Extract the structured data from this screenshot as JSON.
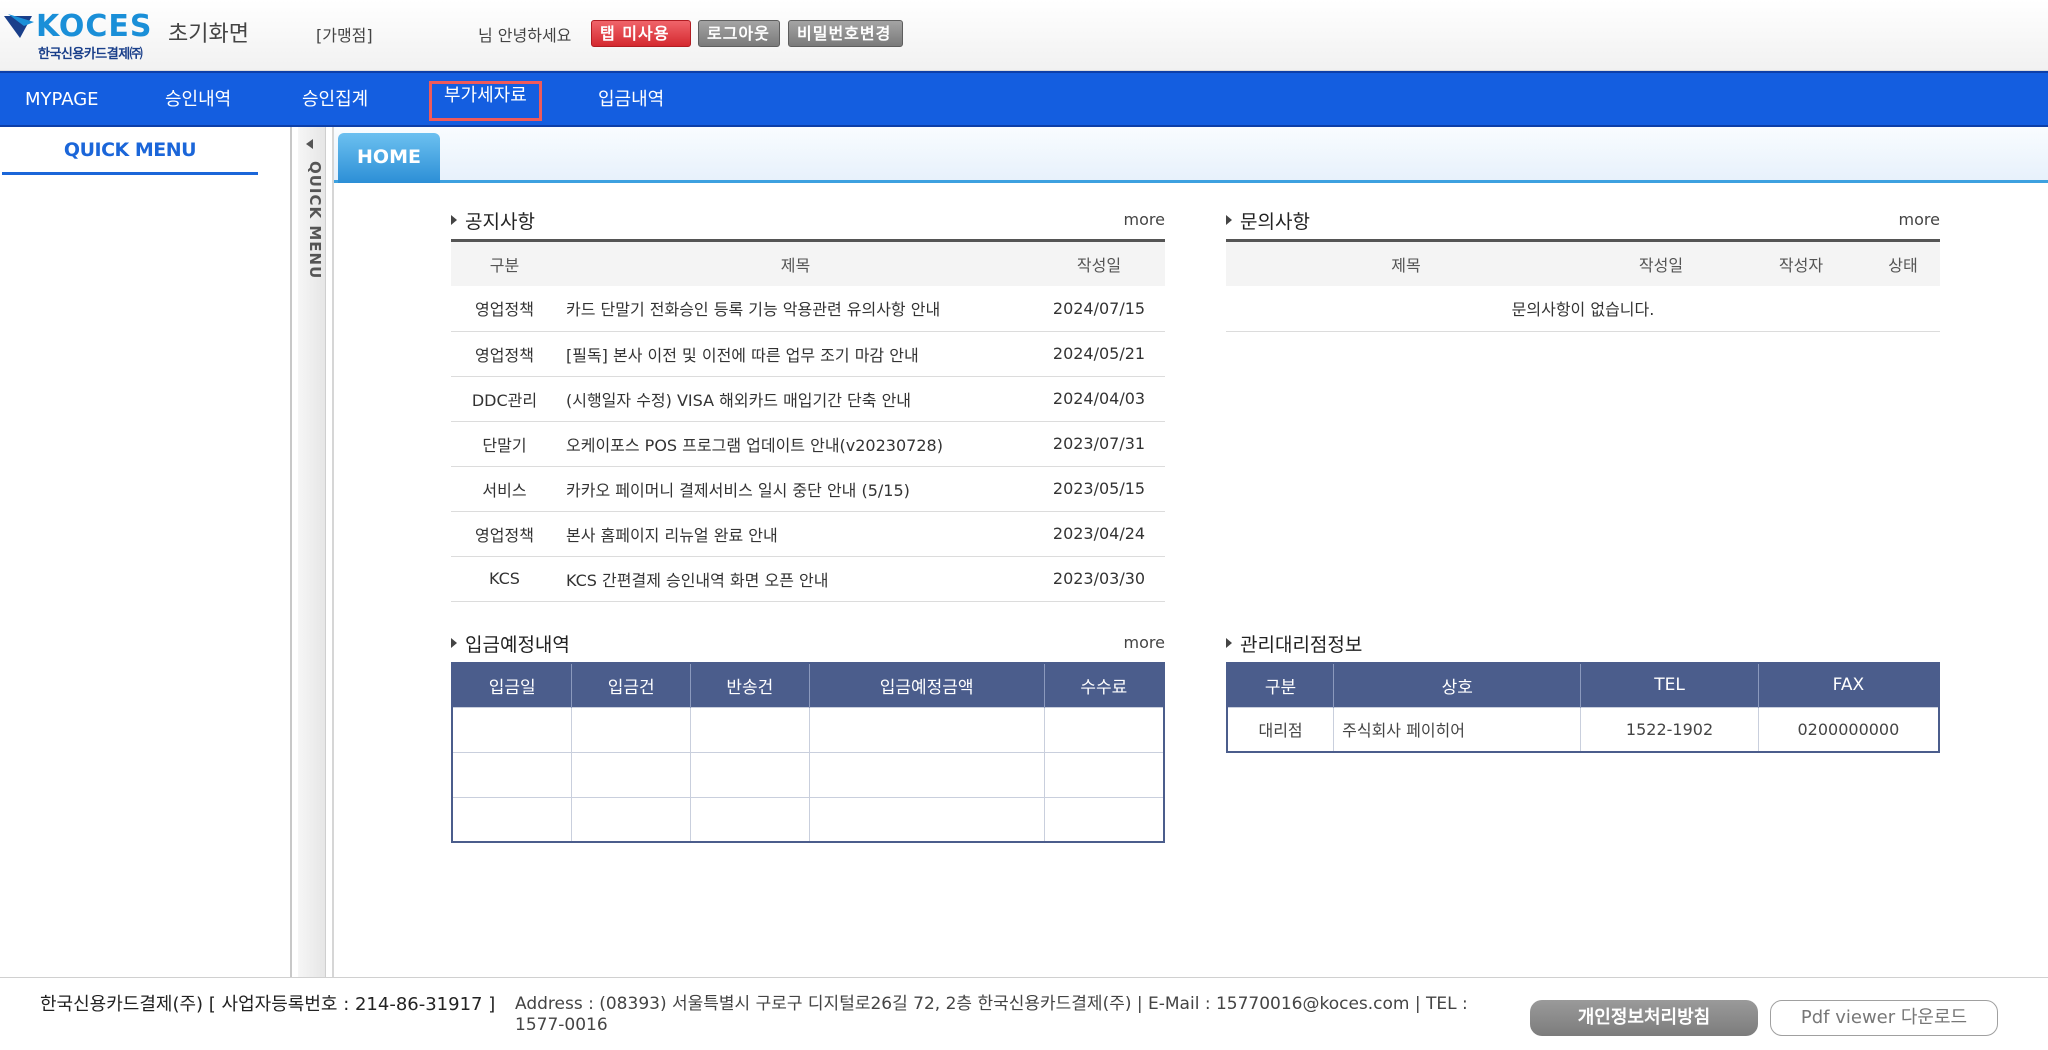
{
  "header": {
    "logo_text": "KOCES",
    "logo_sub": "한국신용카드결제㈜",
    "page_title": "초기화면",
    "merchant_label": "[가맹점]",
    "greeting": "님 안녕하세요",
    "btn_tab_off": "탭 미사용",
    "btn_logout": "로그아웃",
    "btn_change_pw": "비밀번호변경"
  },
  "nav": {
    "items": [
      "MYPAGE",
      "승인내역",
      "승인집계",
      "부가세자료",
      "입금내역"
    ]
  },
  "quick_menu": {
    "title": "QUICK MENU",
    "tab_label": "QUICK MENU"
  },
  "home_tab": "HOME",
  "notice": {
    "title": "공지사항",
    "more": "more",
    "headers": [
      "구분",
      "제목",
      "작성일"
    ],
    "rows": [
      {
        "cat": "영업정책",
        "title": "카드 단말기 전화승인 등록 기능 악용관련 유의사항 안내",
        "date": "2024/07/15"
      },
      {
        "cat": "영업정책",
        "title": "[필독] 본사 이전 및 이전에 따른 업무 조기 마감 안내",
        "date": "2024/05/21"
      },
      {
        "cat": "DDC관리",
        "title": "(시행일자 수정) VISA 해외카드 매입기간 단축 안내",
        "date": "2024/04/03"
      },
      {
        "cat": "단말기",
        "title": "오케이포스 POS 프로그램 업데이트 안내(v20230728)",
        "date": "2023/07/31"
      },
      {
        "cat": "서비스",
        "title": "카카오 페이머니 결제서비스 일시 중단 안내 (5/15)",
        "date": "2023/05/15"
      },
      {
        "cat": "영업정책",
        "title": "본사 홈페이지 리뉴얼 완료 안내",
        "date": "2023/04/24"
      },
      {
        "cat": "KCS",
        "title": "KCS 간편결제 승인내역 화면 오픈 안내",
        "date": "2023/03/30"
      }
    ]
  },
  "inquiry": {
    "title": "문의사항",
    "more": "more",
    "headers": [
      "제목",
      "작성일",
      "작성자",
      "상태"
    ],
    "empty": "문의사항이 없습니다."
  },
  "deposit": {
    "title": "입금예정내역",
    "more": "more",
    "headers": [
      "입금일",
      "입금건",
      "반송건",
      "입금예정금액",
      "수수료"
    ]
  },
  "agency": {
    "title": "관리대리점정보",
    "headers": [
      "구분",
      "상호",
      "TEL",
      "FAX"
    ],
    "row": {
      "type": "대리점",
      "name": "주식회사 페이히어",
      "tel": "1522-1902",
      "fax": "0200000000"
    }
  },
  "footer": {
    "company": "한국신용카드결제(주) [ 사업자등록번호 : 214-86-31917 ]",
    "address": "Address : (08393) 서울특별시 구로구 디지털로26길 72, 2층 한국신용카드결제(주) | E-Mail : 15770016@koces.com | TEL : 1577-0016",
    "btn_privacy": "개인정보처리방침",
    "btn_pdf": "Pdf viewer 다운로드"
  },
  "colors": {
    "nav_bg": "#145ee0",
    "accent_red": "#d8453b",
    "table_head": "#4b5d8c"
  }
}
